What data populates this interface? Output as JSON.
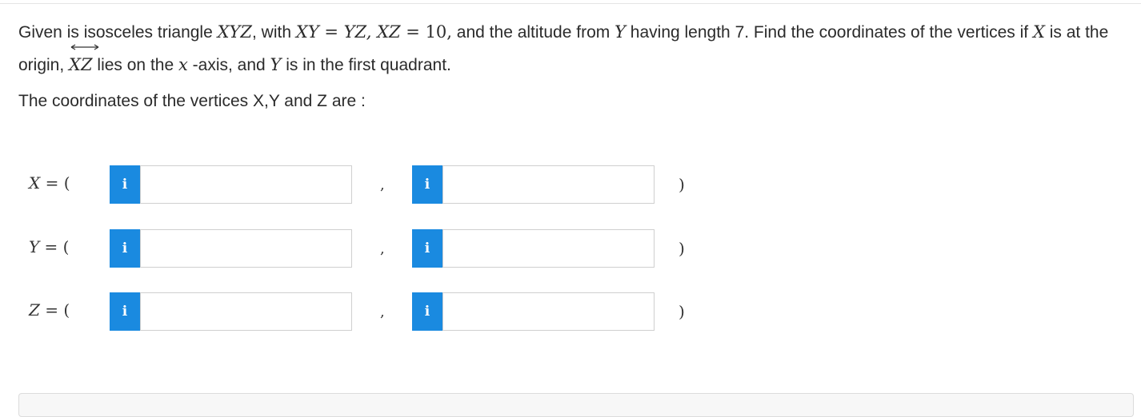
{
  "question": {
    "t1": "Given is isosceles triangle ",
    "m_xyz": "XYZ",
    "t2": ", with ",
    "m_eq1": "XY = YZ, XZ = ",
    "m_ten": "10,",
    "t3": " and the altitude from ",
    "m_y": "Y",
    "t4": " having length 7. Find the coordinates of the vertices if ",
    "m_x": "X",
    "t5": " is at the origin, ",
    "m_line": "XZ",
    "t6": " lies on the ",
    "m_xaxis": "x",
    "t7": " -axis, and ",
    "m_y2": "Y",
    "t8": " is in the first quadrant."
  },
  "prompt": "The coordinates of the vertices X,Y and Z are :",
  "rows": [
    {
      "var": "X",
      "eq": " = (",
      "x_value": "",
      "y_value": "",
      "comma": ",",
      "close": ")"
    },
    {
      "var": "Y",
      "eq": " = (",
      "x_value": "",
      "y_value": "",
      "comma": ",",
      "close": ")"
    },
    {
      "var": "Z",
      "eq": " = (",
      "x_value": "",
      "y_value": "",
      "comma": ",",
      "close": ")"
    }
  ],
  "info_icon_glyph": "i",
  "colors": {
    "info_button": "#1a8ae0"
  }
}
